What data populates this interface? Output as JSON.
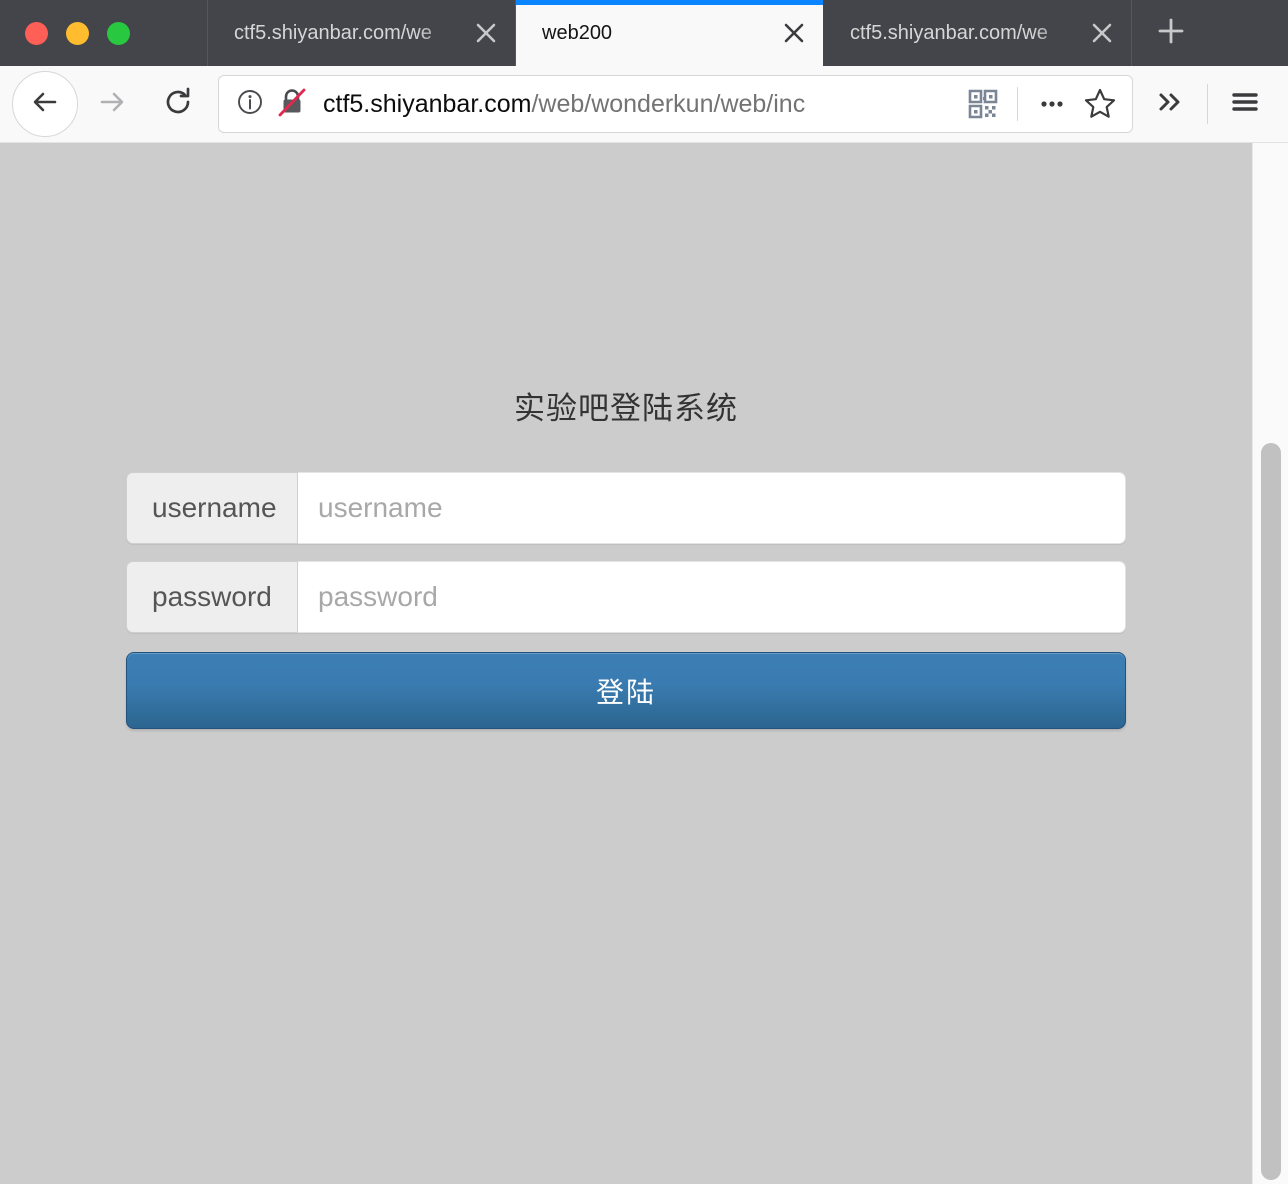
{
  "window": {
    "traffic_lights": [
      {
        "name": "close",
        "color": "#ff5f57"
      },
      {
        "name": "minimize",
        "color": "#febc2e"
      },
      {
        "name": "zoom",
        "color": "#28c840"
      }
    ]
  },
  "tabs": [
    {
      "title": "ctf5.shiyanbar.com/we",
      "active": false
    },
    {
      "title": "web200",
      "active": true
    },
    {
      "title": "ctf5.shiyanbar.com/we",
      "active": false
    }
  ],
  "new_tab_label": "+",
  "navigation": {
    "back_label": "Back",
    "forward_label": "Forward",
    "reload_label": "Reload",
    "overflow_label": "More tools",
    "menu_label": "Open menu"
  },
  "urlbar": {
    "info_icon": "info-circle-icon",
    "security_icon": "crossed-out-lock-icon",
    "url_domain": "ctf5.shiyanbar.com",
    "url_path": "/web/wonderkun/web/inc",
    "qr_icon": "qr-code-icon",
    "page_actions_label": "...",
    "bookmark_label": "Bookmark this page"
  },
  "page": {
    "title": "实验吧登陆系统",
    "fields": [
      {
        "name": "username",
        "addon_label": "username",
        "placeholder": "username",
        "value": "",
        "type": "text"
      },
      {
        "name": "password",
        "addon_label": "password",
        "placeholder": "password",
        "value": "",
        "type": "text"
      }
    ],
    "submit_label": "登陆",
    "background_color": "#cccccc",
    "accent_color": "#3a7cb1"
  }
}
